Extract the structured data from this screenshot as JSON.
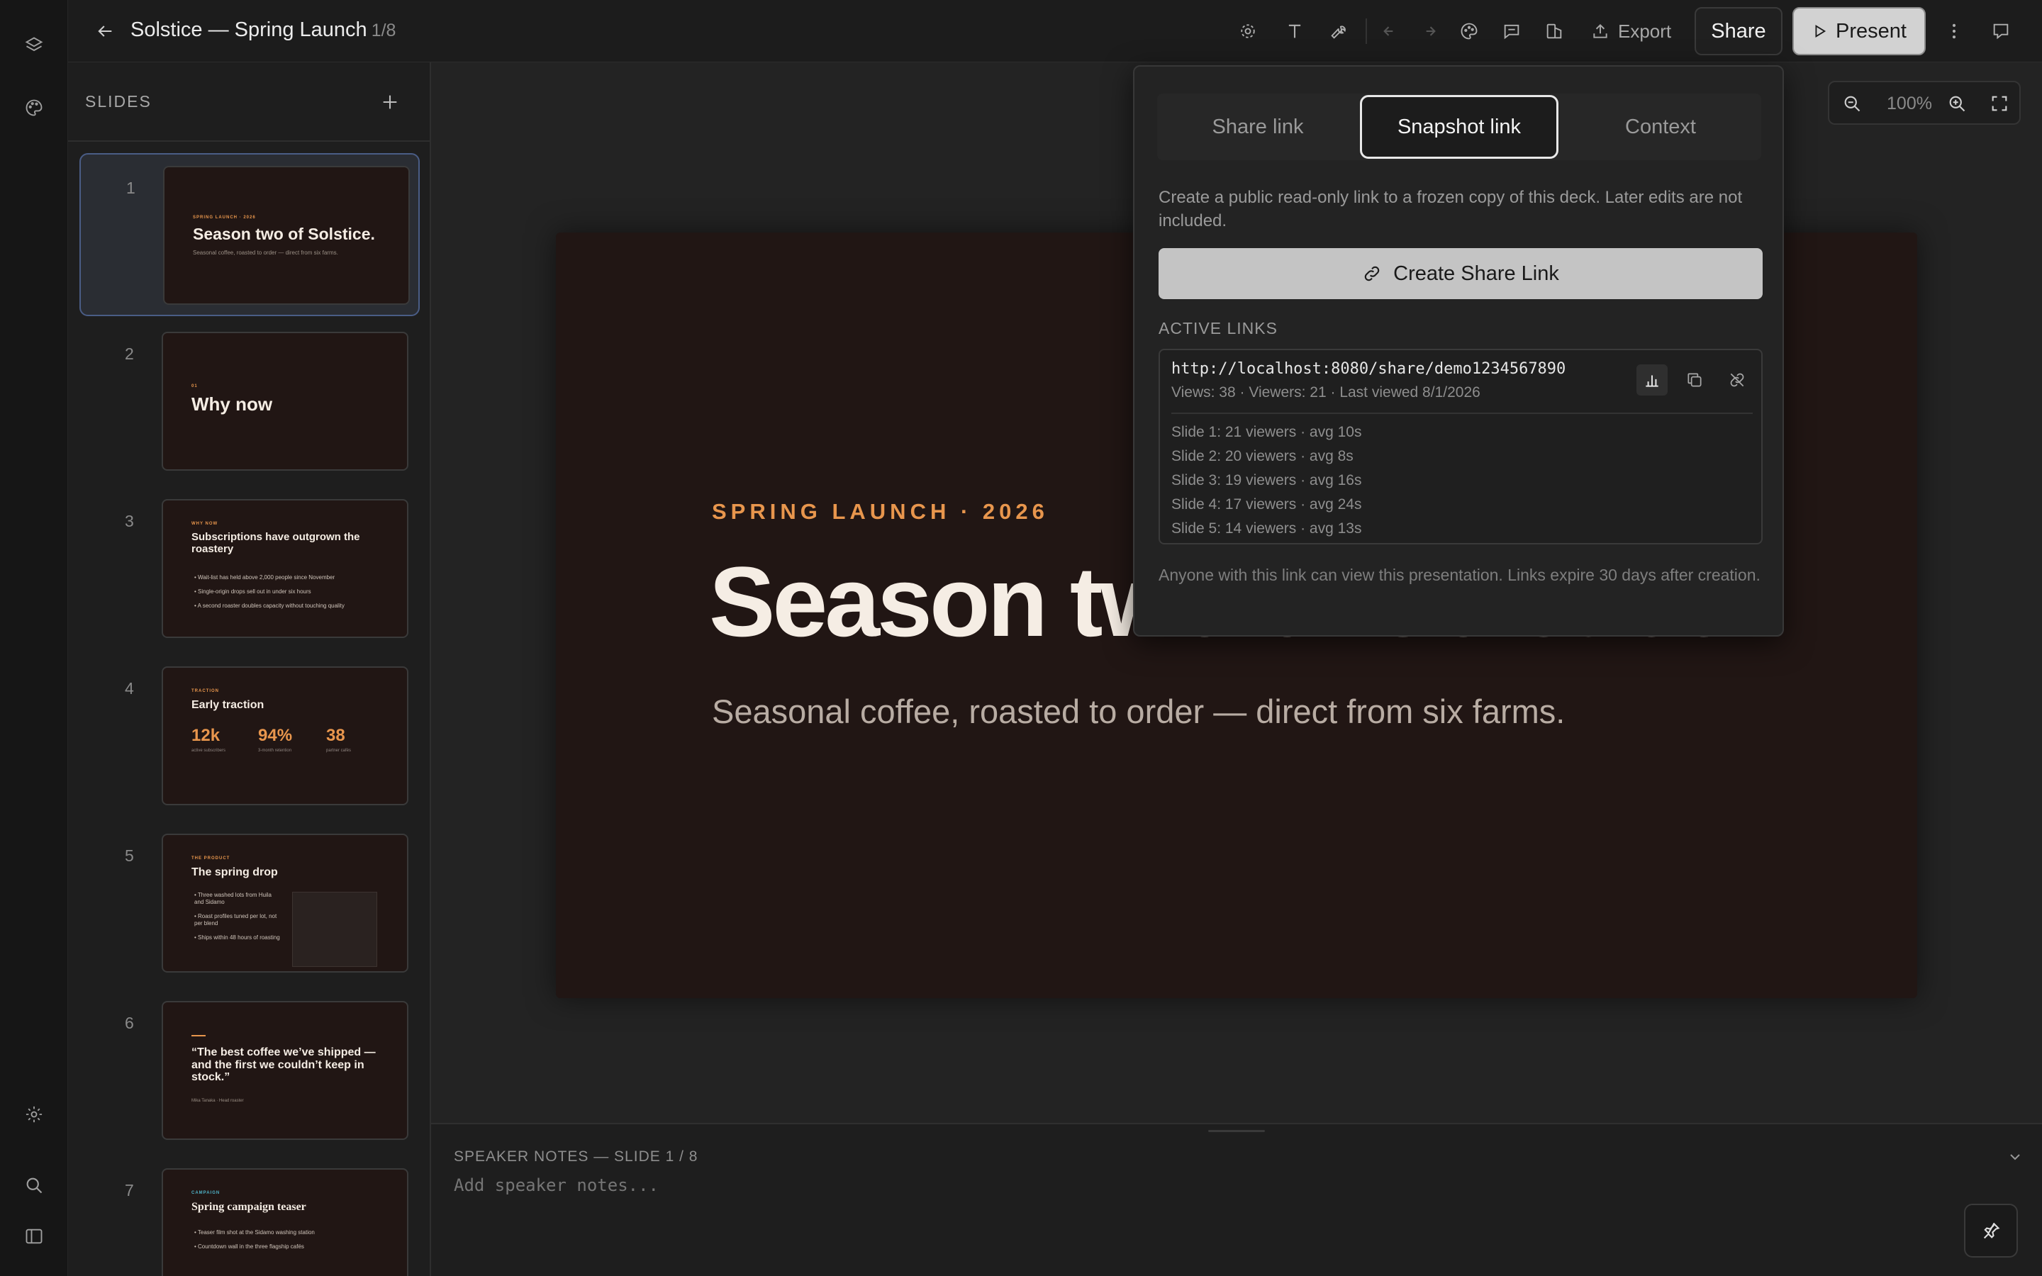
{
  "app": {
    "title": "Solstice — Spring Launch",
    "slide_counter": "1/8"
  },
  "toolbar": {
    "export_label": "Export",
    "share_label": "Share",
    "present_label": "Present"
  },
  "slides_panel": {
    "header": "SLIDES",
    "slides": [
      {
        "num": "1",
        "eyebrow": "SPRING LAUNCH · 2026",
        "title": "Season two of Solstice.",
        "sub": "Seasonal coffee, roasted to order — direct from six farms."
      },
      {
        "num": "2",
        "eyebrow": "01",
        "title": "Why now"
      },
      {
        "num": "3",
        "eyebrow": "WHY NOW",
        "title": "Subscriptions have outgrown the roastery",
        "bullets": [
          "Wait-list has held above 2,000 people since November",
          "Single-origin drops sell out in under six hours",
          "A second roaster doubles capacity without touching quality"
        ]
      },
      {
        "num": "4",
        "eyebrow": "TRACTION",
        "title": "Early traction",
        "stats": [
          {
            "value": "12k",
            "label": "active subscribers"
          },
          {
            "value": "94%",
            "label": "3-month retention"
          },
          {
            "value": "38",
            "label": "partner cafés"
          }
        ]
      },
      {
        "num": "5",
        "eyebrow": "THE PRODUCT",
        "title": "The spring drop",
        "bullets": [
          "Three washed lots from Huila and Sidamo",
          "Roast profiles tuned per lot, not per blend",
          "Ships within 48 hours of roasting"
        ]
      },
      {
        "num": "6",
        "quote": "“The best coffee we’ve shipped — and the first we couldn’t keep in stock.”",
        "attribution": "Mika Tanaka · Head roaster"
      },
      {
        "num": "7",
        "eyebrow": "CAMPAIGN",
        "title": "Spring campaign teaser",
        "bullets": [
          "Teaser film shot at the Sidamo washing station",
          "Countdown wall in the three flagship cafés"
        ]
      }
    ]
  },
  "canvas": {
    "zoom": "100%",
    "slide": {
      "eyebrow": "SPRING LAUNCH · 2026",
      "title": "Season two of Solstice.",
      "subtitle": "Seasonal coffee, roasted to order — direct from six farms."
    }
  },
  "share_popover": {
    "tabs": [
      "Share link",
      "Snapshot link",
      "Context"
    ],
    "active_tab": "Snapshot link",
    "description": "Create a public read-only link to a frozen copy of this deck. Later edits are not included.",
    "create_button": "Create Share Link",
    "active_links_label": "ACTIVE LINKS",
    "link": {
      "url": "http://localhost:8080/share/demo1234567890",
      "meta": "Views: 38 · Viewers: 21 · Last viewed 8/1/2026",
      "stats": [
        "Slide 1: 21 viewers · avg 10s",
        "Slide 2: 20 viewers · avg 8s",
        "Slide 3: 19 viewers · avg 16s",
        "Slide 4: 17 viewers · avg 24s",
        "Slide 5: 14 viewers · avg 13s"
      ]
    },
    "footer": "Anyone with this link can view this presentation. Links expire 30 days after creation."
  },
  "notes": {
    "label": "SPEAKER NOTES — SLIDE 1 / 8",
    "placeholder": "Add speaker notes..."
  },
  "colors": {
    "accent": "#e8964d",
    "slide_bg": "#211614",
    "active_slide_border": "#4a5d86"
  }
}
